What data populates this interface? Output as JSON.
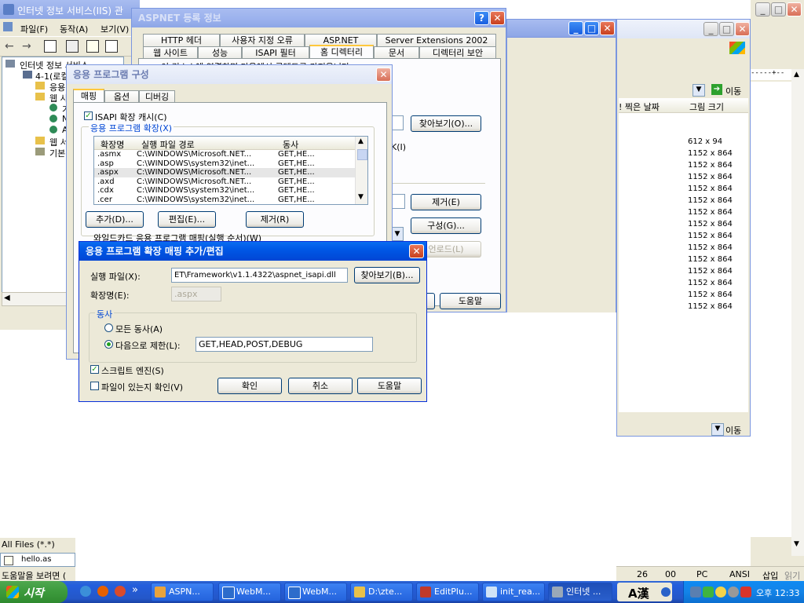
{
  "iis_window": {
    "title": "인터넷 정보 서비스(IIS) 관",
    "menu": [
      "파일(F)",
      "동작(A)",
      "보기(V)"
    ],
    "tree": [
      "인터넷 정보 서비스",
      "4-1(로컬",
      "응용",
      "웹 사",
      "기",
      "N",
      "A",
      "웹 서",
      "기본"
    ]
  },
  "files_panel": {
    "filter": "All Files (*.*)",
    "file": "hello.as",
    "status": "도움말을 보려면 ("
  },
  "explorer_window": {
    "go_label": "이동",
    "col_date": "! 찍은 날짜",
    "col_size": "그림 크기",
    "sizes": [
      "612 x 94",
      "1152 x 864",
      "1152 x 864",
      "1152 x 864",
      "1152 x 864",
      "1152 x 864",
      "1152 x 864",
      "1152 x 864",
      "1152 x 864",
      "1152 x 864",
      "1152 x 864",
      "1152 x 864",
      "1152 x 864",
      "1152 x 864",
      "1152 x 864"
    ],
    "bottom_go": "이동"
  },
  "editor_status": {
    "line": "26",
    "col": "00",
    "mode": "PC",
    "enc": "ANSI",
    "ins": "삽입",
    "ro": "읽기"
  },
  "aspnet_dialog": {
    "title": "ASPNET 등록 정보",
    "tabs_row1": [
      "HTTP 헤더",
      "사용자 지정 오류",
      "ASP.NET",
      "Server Extensions 2002"
    ],
    "tabs_row2": [
      "웹 사이트",
      "성능",
      "ISAPI 필터",
      "홈 디렉터리",
      "문서",
      "디렉터리 보안"
    ],
    "intro": "이 리소스에 연결하면 다음에서 콘텐트를 가져옵니다",
    "browse": "찾아보기(O)...",
    "log_frag": "K(I)",
    "remove": "제거(E)",
    "config": "구성(G)...",
    "unload": "언로드(L)",
    "help": "도움말"
  },
  "app_config": {
    "title": "응용 프로그램 구성",
    "tabs": [
      "매핑",
      "옵션",
      "디버깅"
    ],
    "isapi_cache": "ISAPI 확장 캐시(C)",
    "group_label": "응용 프로그램 확장(X)",
    "columns": [
      "확장명",
      "실행 파일 경로",
      "동사"
    ],
    "rows": [
      {
        "ext": ".asmx",
        "path": "C:\\WINDOWS\\Microsoft.NET...",
        "verb": "GET,HE..."
      },
      {
        "ext": ".asp",
        "path": "C:\\WINDOWS\\system32\\inet...",
        "verb": "GET,HE..."
      },
      {
        "ext": ".aspx",
        "path": "C:\\WINDOWS\\Microsoft.NET...",
        "verb": "GET,HE..."
      },
      {
        "ext": ".axd",
        "path": "C:\\WINDOWS\\Microsoft.NET...",
        "verb": "GET,HE..."
      },
      {
        "ext": ".cdx",
        "path": "C:\\WINDOWS\\system32\\inet...",
        "verb": "GET,HE..."
      },
      {
        "ext": ".cer",
        "path": "C:\\WINDOWS\\system32\\inet...",
        "verb": "GET,HE..."
      }
    ],
    "add": "추가(D)...",
    "edit": "편집(E)...",
    "remove": "제거(R)",
    "wildcard": "와일드카드 응용 프로그램 매핑(실행 순서)(W)"
  },
  "mapping_dialog": {
    "title": "응용 프로그램 확장 매핑 추가/편집",
    "exe_label": "실행 파일(X):",
    "exe_value": "ET\\Framework\\v1.1.4322\\aspnet_isapi.dll",
    "browse": "찾아보기(B)...",
    "ext_label": "확장명(E):",
    "ext_value": ".aspx",
    "verbs_group": "동사",
    "all_verbs": "모든 동사(A)",
    "limit_to": "다음으로 제한(L):",
    "limit_value": "GET,HEAD,POST,DEBUG",
    "script_engine": "스크립트 엔진(S)",
    "check_file": "파일이 있는지 확인(V)",
    "ok": "확인",
    "cancel": "취소",
    "help": "도움말"
  },
  "taskbar": {
    "start": "시작",
    "quick_more": "»",
    "items": [
      "ASPN...",
      "WebM...",
      "WebM...",
      "D:\\zte...",
      "EditPlu...",
      "init_rea...",
      "인터넷 ..."
    ],
    "ime": "A漢",
    "clock": "오후 12:33"
  }
}
